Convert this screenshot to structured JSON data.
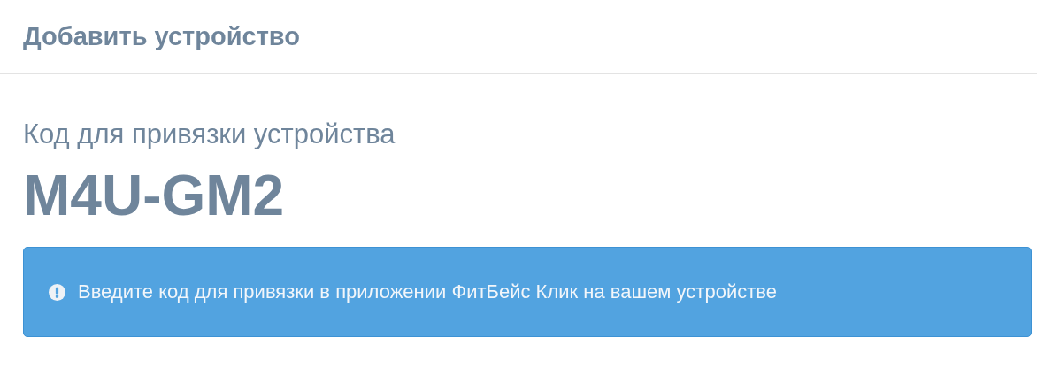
{
  "header": {
    "title": "Добавить устройство"
  },
  "code_label": "Код для привязки устройства",
  "code": "M4U-GM2",
  "alert": {
    "kind": "info",
    "text": "Введите код для привязки в приложении ФитБейс Клик на вашем устройстве"
  }
}
